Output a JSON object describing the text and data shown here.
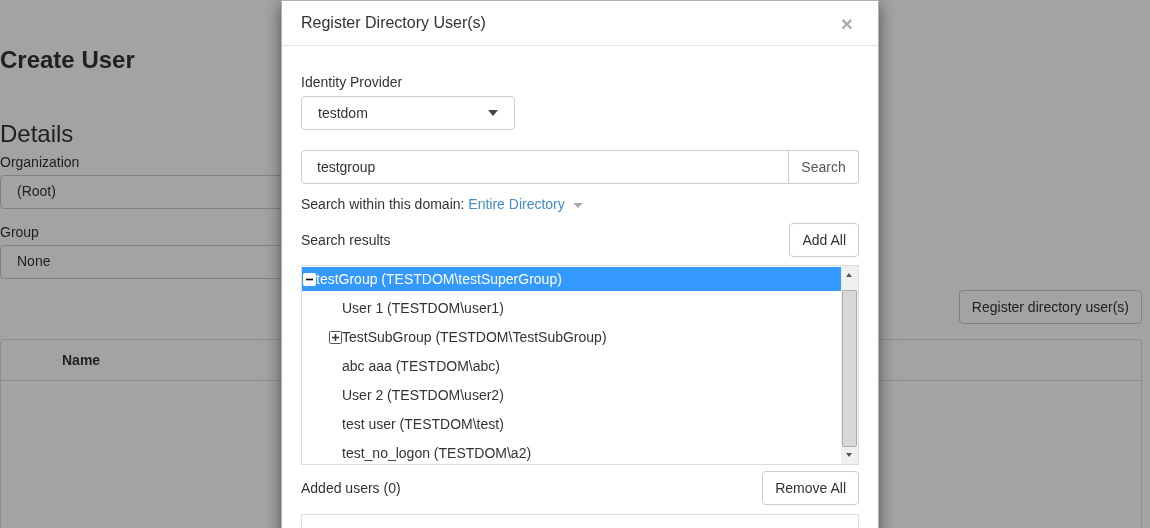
{
  "page": {
    "title": "Create User",
    "section": "Details",
    "fields": [
      {
        "label": "Organization",
        "value": "(Root)"
      },
      {
        "label": "Group",
        "value": "None"
      }
    ],
    "register_button": "Register directory user(s)",
    "table": {
      "columns": [
        "Name"
      ]
    }
  },
  "dialog": {
    "title": "Register Directory User(s)",
    "close": "×",
    "identity_provider": {
      "label": "Identity Provider",
      "value": "testdom"
    },
    "search": {
      "value": "testgroup",
      "button": "Search"
    },
    "scope": {
      "label": "Search within this domain:",
      "value": "Entire Directory"
    },
    "results": {
      "label": "Search results",
      "add_all": "Add All",
      "items": [
        {
          "kind": "group",
          "label": "testGroup (TESTDOM\\testSuperGroup)",
          "expanded": true,
          "selected": true,
          "children": [
            {
              "kind": "user",
              "label": "User 1 (TESTDOM\\user1)",
              "selected": false
            },
            {
              "kind": "group",
              "label": "TestSubGroup (TESTDOM\\TestSubGroup)",
              "expanded": false,
              "selected": false
            },
            {
              "kind": "user",
              "label": "abc aaa (TESTDOM\\abc)",
              "selected": false
            },
            {
              "kind": "user",
              "label": "User 2 (TESTDOM\\user2)",
              "selected": false
            },
            {
              "kind": "user",
              "label": "test user (TESTDOM\\test)",
              "selected": false
            },
            {
              "kind": "user",
              "label": "test_no_logon (TESTDOM\\a2)",
              "selected": false
            }
          ]
        }
      ]
    },
    "added": {
      "label": "Added users (0)",
      "remove_all": "Remove All"
    }
  }
}
